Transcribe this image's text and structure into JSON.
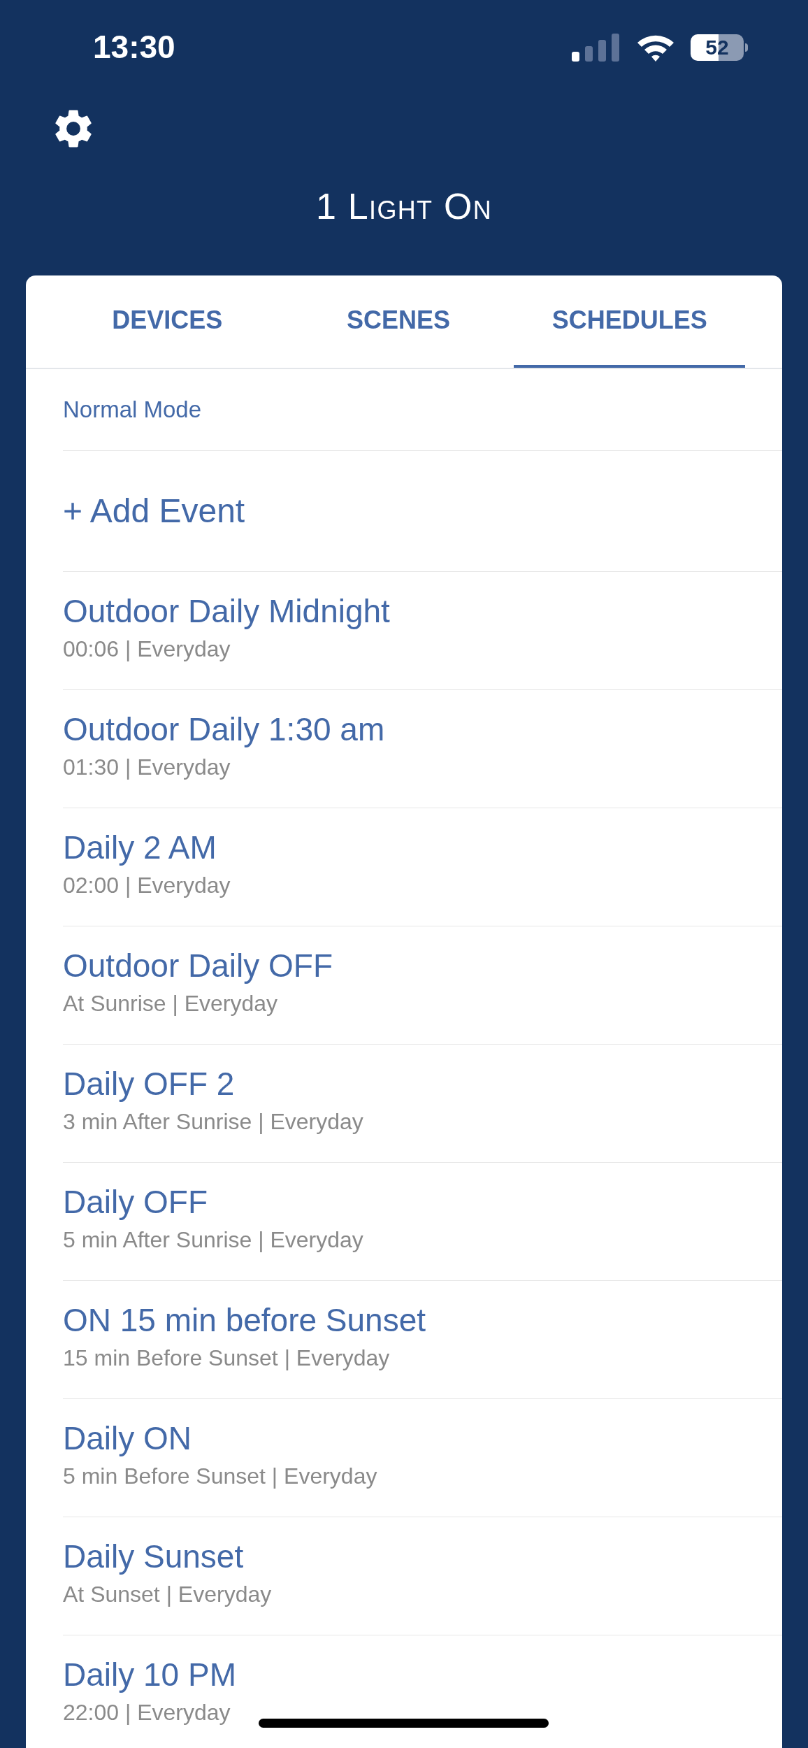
{
  "status_bar": {
    "time": "13:30",
    "battery": "52"
  },
  "header": {
    "title": "1 Light On"
  },
  "tabs": [
    {
      "label": "DEVICES",
      "selected": false
    },
    {
      "label": "SCENES",
      "selected": false
    },
    {
      "label": "SCHEDULES",
      "selected": true
    }
  ],
  "mode": "Normal Mode",
  "add_event": "+ Add Event",
  "events": [
    {
      "title": "Outdoor Daily Midnight",
      "detail": "00:06 | Everyday"
    },
    {
      "title": "Outdoor Daily 1:30 am",
      "detail": "01:30 | Everyday"
    },
    {
      "title": "Daily 2 AM",
      "detail": "02:00 | Everyday"
    },
    {
      "title": "Outdoor Daily OFF",
      "detail": "At Sunrise | Everyday"
    },
    {
      "title": "Daily OFF 2",
      "detail": "3 min After Sunrise | Everyday"
    },
    {
      "title": "Daily OFF",
      "detail": "5 min After Sunrise | Everyday"
    },
    {
      "title": "ON 15 min before Sunset",
      "detail": "15 min Before Sunset | Everyday"
    },
    {
      "title": "Daily ON",
      "detail": "5 min Before Sunset | Everyday"
    },
    {
      "title": "Daily Sunset",
      "detail": "At Sunset | Everyday"
    },
    {
      "title": "Daily 10 PM",
      "detail": "22:00 | Everyday"
    }
  ]
}
